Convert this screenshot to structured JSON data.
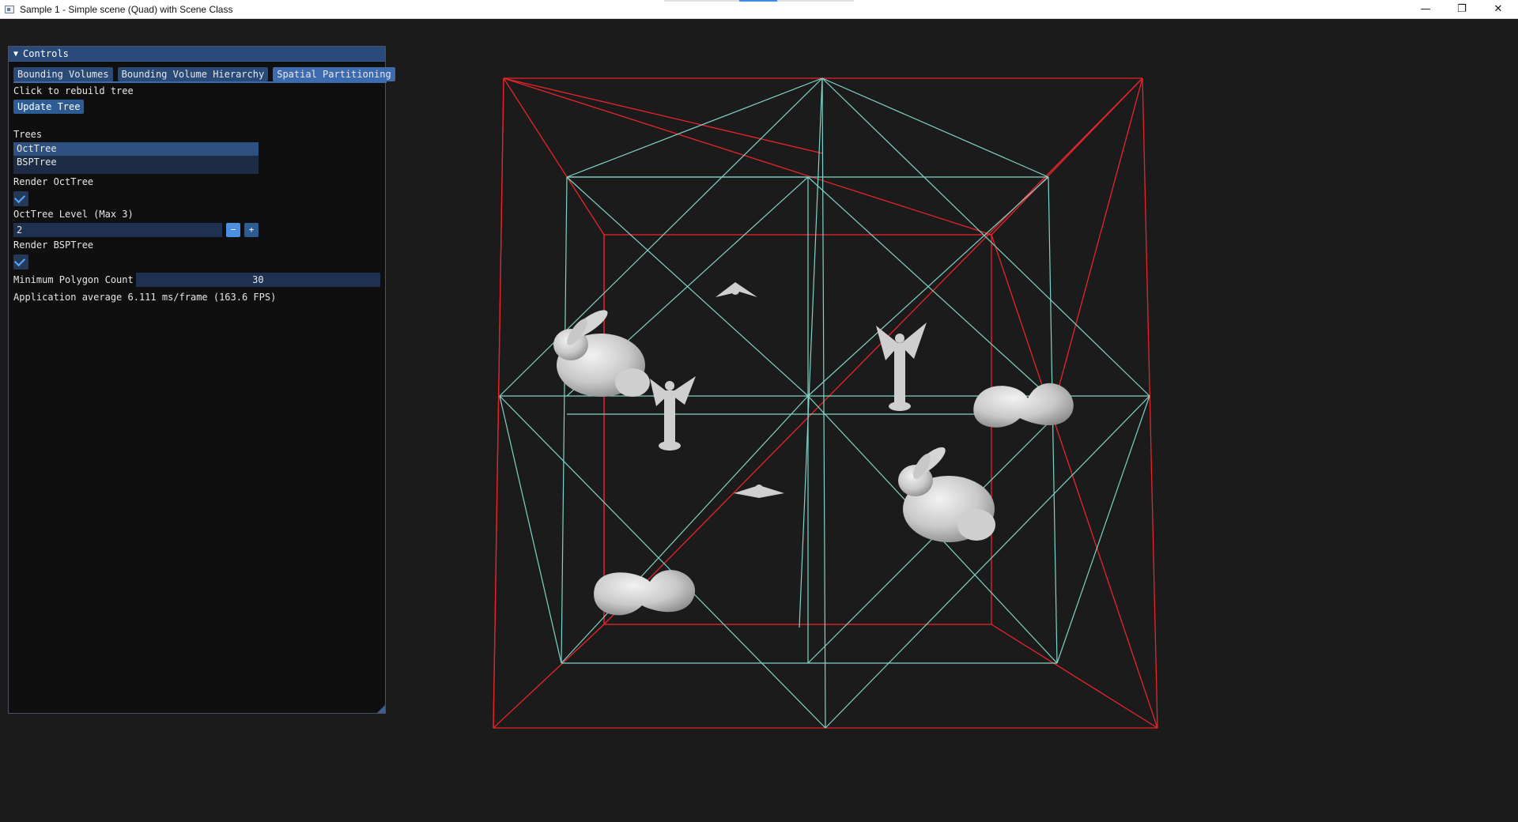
{
  "window": {
    "title": "Sample 1 - Simple scene (Quad) with Scene Class",
    "minimize_glyph": "—",
    "restore_glyph": "❐",
    "close_glyph": "✕"
  },
  "controls": {
    "header": "Controls",
    "tabs": [
      "Bounding Volumes",
      "Bounding Volume Hierarchy",
      "Spatial Partitioning"
    ],
    "active_tab": "Spatial Partitioning",
    "rebuild_hint": "Click to rebuild tree",
    "update_button": "Update Tree",
    "trees_label": "Trees",
    "trees": [
      "OctTree",
      "BSPTree"
    ],
    "selected_tree": "OctTree",
    "render_octtree_label": "Render OctTree",
    "render_octtree": true,
    "octtree_level_label": "OctTree Level (Max 3)",
    "octtree_level": "2",
    "minus_label": "−",
    "plus_label": "+",
    "render_bsptree_label": "Render BSPTree",
    "render_bsptree": true,
    "min_polygon_label": "Minimum Polygon Count",
    "min_polygon_value": "30",
    "stats": "Application average 6.111 ms/frame (163.6 FPS)"
  },
  "scene": {
    "octree_color": "#e8242a",
    "bsp_color": "#7fd3c8",
    "model_color": "#d9d9d9",
    "objects": [
      "bunny-model",
      "bunny-model",
      "angel-statue",
      "angel-statue",
      "blob-shape",
      "blob-shape",
      "small-creature",
      "small-creature"
    ]
  }
}
